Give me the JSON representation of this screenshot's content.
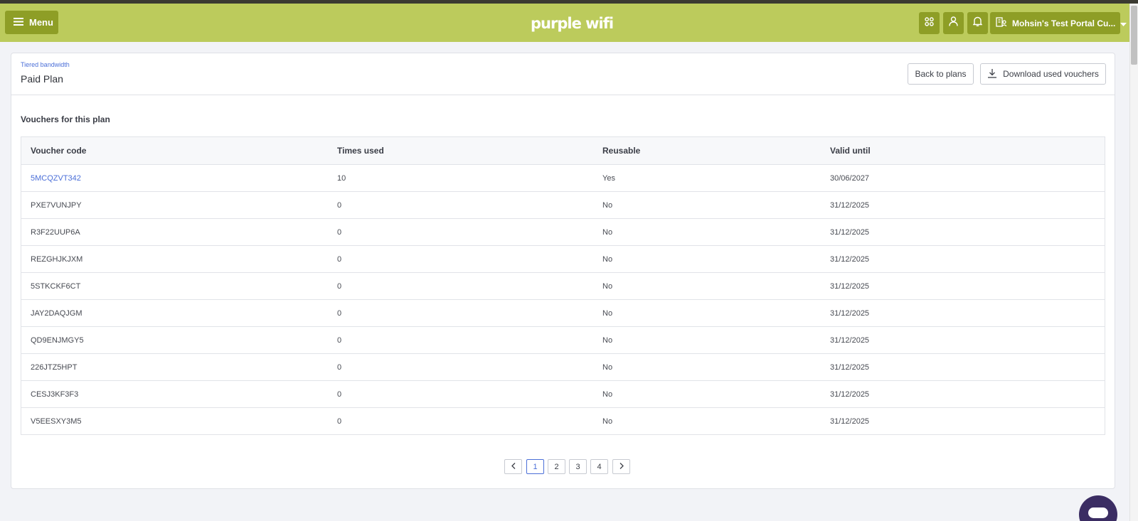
{
  "header": {
    "menu_label": "Menu",
    "logo_text": "purple wifi",
    "venue_label": "Mohsin's Test Portal Cu...",
    "accent_color": "#bccb5c",
    "button_color": "#8e9e26"
  },
  "plan": {
    "breadcrumb": "Tiered bandwidth",
    "title": "Paid Plan",
    "back_label": "Back to plans",
    "download_label": "Download used vouchers"
  },
  "vouchers": {
    "section_title": "Vouchers for this plan",
    "columns": [
      "Voucher code",
      "Times used",
      "Reusable",
      "Valid until"
    ],
    "rows": [
      {
        "code": "5MCQZVT342",
        "times_used": "10",
        "reusable": "Yes",
        "valid_until": "30/06/2027"
      },
      {
        "code": "PXE7VUNJPY",
        "times_used": "0",
        "reusable": "No",
        "valid_until": "31/12/2025"
      },
      {
        "code": "R3F22UUP6A",
        "times_used": "0",
        "reusable": "No",
        "valid_until": "31/12/2025"
      },
      {
        "code": "REZGHJKJXM",
        "times_used": "0",
        "reusable": "No",
        "valid_until": "31/12/2025"
      },
      {
        "code": "5STKCKF6CT",
        "times_used": "0",
        "reusable": "No",
        "valid_until": "31/12/2025"
      },
      {
        "code": "JAY2DAQJGM",
        "times_used": "0",
        "reusable": "No",
        "valid_until": "31/12/2025"
      },
      {
        "code": "QD9ENJMGY5",
        "times_used": "0",
        "reusable": "No",
        "valid_until": "31/12/2025"
      },
      {
        "code": "226JTZ5HPT",
        "times_used": "0",
        "reusable": "No",
        "valid_until": "31/12/2025"
      },
      {
        "code": "CESJ3KF3F3",
        "times_used": "0",
        "reusable": "No",
        "valid_until": "31/12/2025"
      },
      {
        "code": "V5EESXY3M5",
        "times_used": "0",
        "reusable": "No",
        "valid_until": "31/12/2025"
      }
    ]
  },
  "pagination": {
    "pages": [
      "1",
      "2",
      "3",
      "4"
    ],
    "current": "1"
  }
}
